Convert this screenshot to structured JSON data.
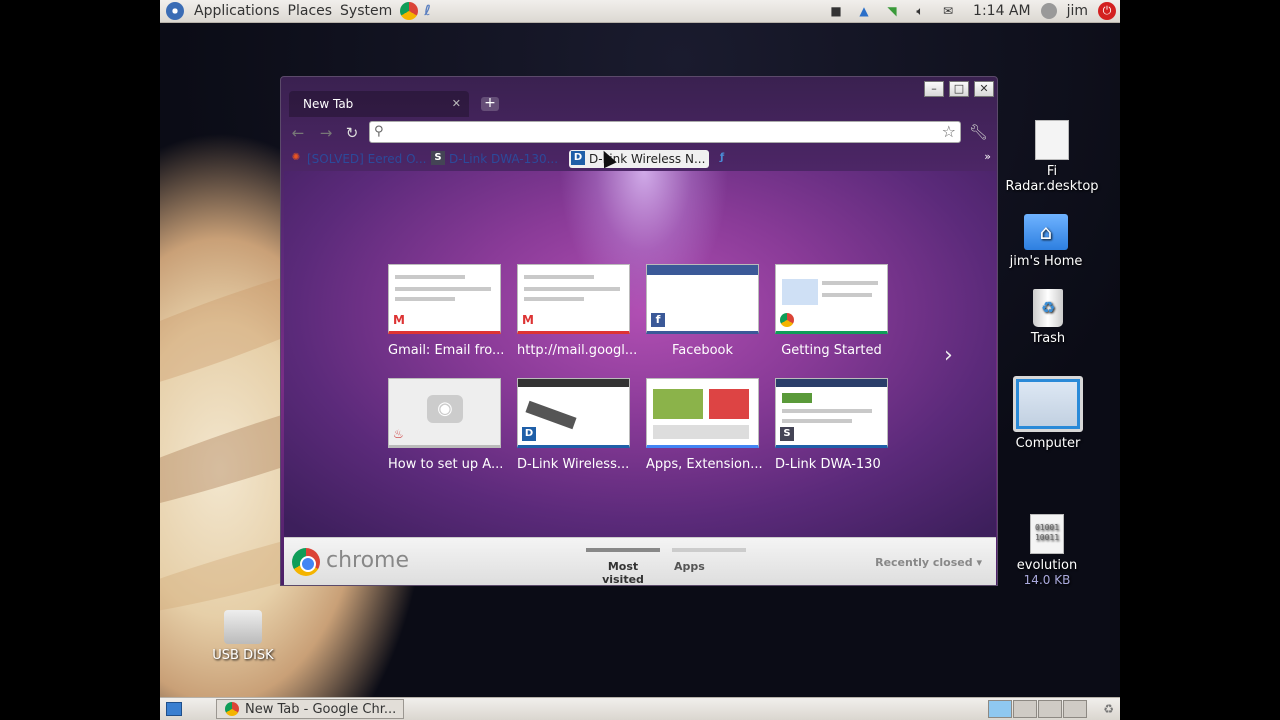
{
  "top_panel": {
    "menus": [
      "Applications",
      "Places",
      "System"
    ],
    "clock": "1:14 AM",
    "user": "jim"
  },
  "desktop": {
    "icons": [
      {
        "label": "Fi Radar.desktop"
      },
      {
        "label": "jim's Home"
      },
      {
        "label": "Trash"
      },
      {
        "label": "Computer"
      },
      {
        "label": "evolution",
        "sublabel": "14.0 KB"
      },
      {
        "label": "USB DISK"
      }
    ]
  },
  "chrome": {
    "tab_title": "New Tab",
    "omnibox_value": "",
    "bookmarks": [
      {
        "label": "[SOLVED] Eered O..."
      },
      {
        "label": "D-Link DWA-130..."
      },
      {
        "label": "D-Link Wireless N..."
      },
      {
        "label": ""
      }
    ],
    "thumbnails": [
      {
        "label": "Gmail: Email fro..."
      },
      {
        "label": "http://mail.googl..."
      },
      {
        "label": "Facebook"
      },
      {
        "label": "Getting Started"
      },
      {
        "label": "How to set up A..."
      },
      {
        "label": "D-Link Wireless..."
      },
      {
        "label": "Apps, Extension..."
      },
      {
        "label": "D-Link DWA-130"
      }
    ],
    "footer": {
      "brand": "chrome",
      "tab_most_visited": "Most visited",
      "tab_apps": "Apps",
      "recently_closed": "Recently closed"
    }
  },
  "taskbar": {
    "task_label": "New Tab - Google Chr..."
  },
  "colors": {
    "ntp_purple": "#8a3b98",
    "bookmark_link": "#2c4a9a"
  }
}
